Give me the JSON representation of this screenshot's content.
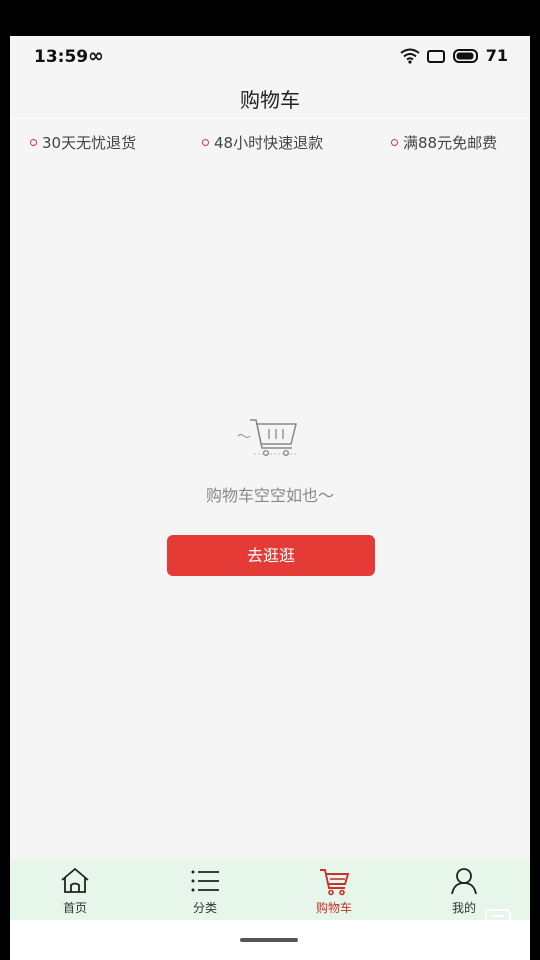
{
  "status_bar": {
    "time": "13:59",
    "extra_icon": "∞",
    "battery": "71"
  },
  "header": {
    "title": "购物车"
  },
  "guarantees": [
    {
      "label": "30天无忧退货"
    },
    {
      "label": "48小时快速退款"
    },
    {
      "label": "满88元免邮费"
    }
  ],
  "empty_state": {
    "icon": "cart-icon",
    "message": "购物车空空如也～",
    "button_label": "去逛逛"
  },
  "bottom_nav": {
    "items": [
      {
        "label": "首页",
        "icon": "home-icon",
        "active": false
      },
      {
        "label": "分类",
        "icon": "list-icon",
        "active": false
      },
      {
        "label": "购物车",
        "icon": "cart-icon",
        "active": true
      },
      {
        "label": "我的",
        "icon": "user-icon",
        "active": false
      }
    ]
  },
  "colors": {
    "accent": "#e43b36",
    "active_tab": "#c7322c",
    "nav_background": "#e6f6ea",
    "page_background": "#f5f5f5"
  }
}
